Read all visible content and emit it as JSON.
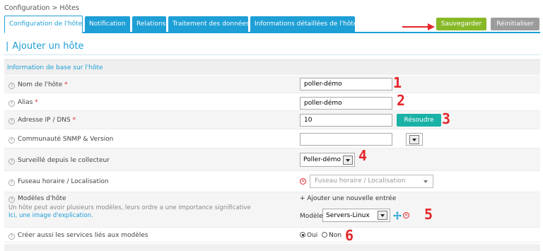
{
  "breadcrumb": "Configuration > Hôtes",
  "tabs": [
    {
      "label": "Configuration de l'hôte"
    },
    {
      "label": "Notification"
    },
    {
      "label": "Relations"
    },
    {
      "label": "Traitement des données"
    },
    {
      "label": "Informations détaillées de l'hôte"
    }
  ],
  "actions": {
    "save": "Sauvegarder",
    "reset": "Réinitialiser"
  },
  "page_title": "Ajouter un hôte",
  "section": "Information de base sur l'hôte",
  "fields": {
    "name": {
      "label": "Nom de l'hôte",
      "required": "*",
      "value": "poller-démo"
    },
    "alias": {
      "label": "Alias",
      "required": "*",
      "value": "poller-démo"
    },
    "address": {
      "label": "Adresse IP / DNS",
      "required": "*",
      "value": "10",
      "button": "Résoudre"
    },
    "snmp": {
      "label": "Communauté SNMP & Version",
      "value": ""
    },
    "monitored_from": {
      "label": "Surveillé depuis le collecteur",
      "value": "Poller-démo"
    },
    "timezone": {
      "label": "Fuseau horaire / Localisation",
      "placeholder": "Fuseau horaire / Localisation"
    },
    "templates": {
      "label": "Modèles d'hôte",
      "add_link": "+ Ajouter une nouvelle entrée",
      "help_text": "Un hôte peut avoir plusieurs modèles, leurs ordre a une importance significative",
      "help_link": "Ici, une image d'explication.",
      "model_label": "Modèle",
      "model_value": "Servers-Linux"
    },
    "create_services": {
      "label": "Créer aussi les services liés aux modèles",
      "yes": "Oui",
      "no": "Non"
    }
  },
  "annotations": [
    "1",
    "2",
    "3",
    "4",
    "5",
    "6"
  ],
  "colors": {
    "accent": "#1e9fd6",
    "save": "#87b927",
    "reset": "#9c9c9c",
    "resolve": "#1ab2a6",
    "annotation": "#e4262a"
  }
}
